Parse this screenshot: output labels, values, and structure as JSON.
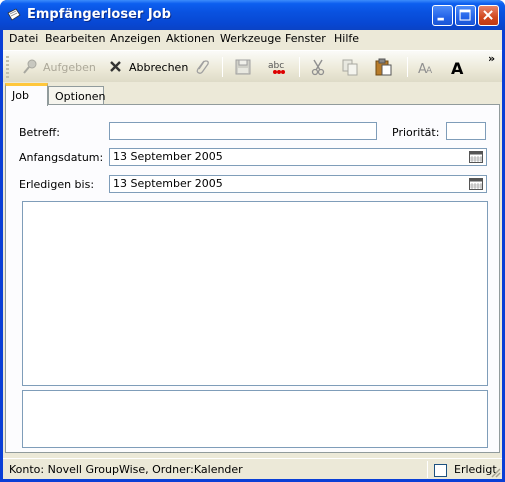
{
  "window": {
    "title": "Empfängerloser Job"
  },
  "menu": [
    {
      "label": "Datei"
    },
    {
      "label": "Bearbeiten"
    },
    {
      "label": "Anzeigen"
    },
    {
      "label": "Aktionen"
    },
    {
      "label": "Werkzeuge"
    },
    {
      "label": "Fenster"
    },
    {
      "label": "Hilfe"
    }
  ],
  "toolbar": {
    "post_label": "Aufgeben",
    "post_icon": "pushpin-icon",
    "cancel_label": "Abbrechen",
    "cancel_icon": "x-icon",
    "chevron": "»"
  },
  "tabs": [
    {
      "label": "Job",
      "active": true
    },
    {
      "label": "Optionen",
      "active": false
    }
  ],
  "form": {
    "subject_label": "Betreff:",
    "subject_value": "",
    "priority_label": "Priorität:",
    "priority_value": "",
    "start_label": "Anfangsdatum:",
    "start_value": "13 September 2005",
    "due_label": "Erledigen bis:",
    "due_value": "13 September 2005"
  },
  "status": {
    "text": "Konto: Novell GroupWise,  Ordner:Kalender",
    "completed_label": "Erledigt",
    "completed_checked": false
  },
  "colors": {
    "titlebar": "#0a5ae6",
    "face": "#ece9d8",
    "tab_highlight": "#ffc73c",
    "field_border": "#7f9db9"
  }
}
